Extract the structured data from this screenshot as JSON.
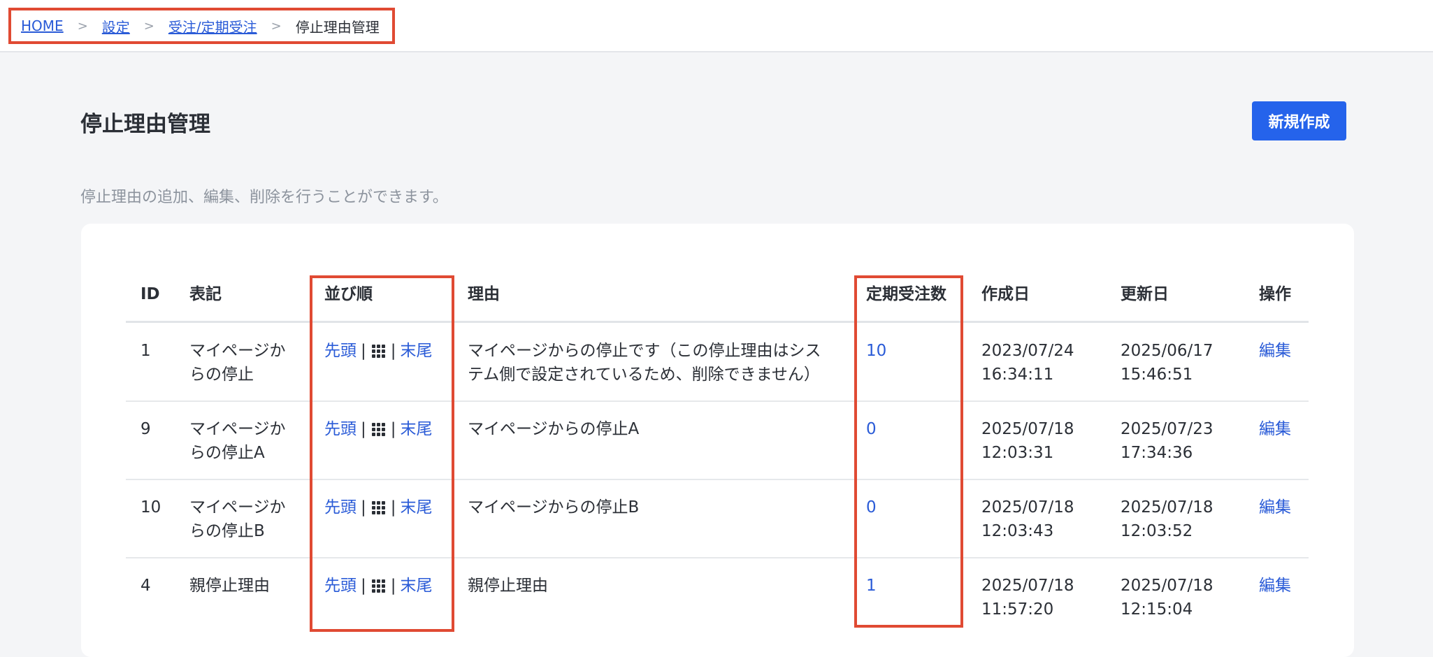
{
  "breadcrumb": {
    "items": [
      "HOME",
      "設定",
      "受注/定期受注"
    ],
    "separator": ">",
    "current": "停止理由管理"
  },
  "page": {
    "title": "停止理由管理",
    "new_button": "新規作成",
    "description": "停止理由の追加、編集、削除を行うことができます。"
  },
  "table": {
    "headers": [
      "ID",
      "表記",
      "並び順",
      "理由",
      "定期受注数",
      "作成日",
      "更新日",
      "操作"
    ],
    "order_controls": {
      "top": "先頭",
      "separator": "|",
      "bottom": "末尾",
      "drag_icon": "grid-drag-handle-icon"
    },
    "rows": [
      {
        "id": "1",
        "label": [
          "マイページか",
          "らの停止"
        ],
        "reason": [
          "マイページからの停止です（この停止理由はシス",
          "テム側で設定されているため、削除できません）"
        ],
        "count": "10",
        "created": [
          "2023/07/24",
          "16:34:11"
        ],
        "updated": [
          "2025/06/17",
          "15:46:51"
        ],
        "action": "編集"
      },
      {
        "id": "9",
        "label": [
          "マイページか",
          "らの停止A"
        ],
        "reason": [
          "マイページからの停止A"
        ],
        "count": "0",
        "created": [
          "2025/07/18",
          "12:03:31"
        ],
        "updated": [
          "2025/07/23",
          "17:34:36"
        ],
        "action": "編集"
      },
      {
        "id": "10",
        "label": [
          "マイページか",
          "らの停止B"
        ],
        "reason": [
          "マイページからの停止B"
        ],
        "count": "0",
        "created": [
          "2025/07/18",
          "12:03:43"
        ],
        "updated": [
          "2025/07/18",
          "12:03:52"
        ],
        "action": "編集"
      },
      {
        "id": "4",
        "label": [
          "親停止理由"
        ],
        "reason": [
          "親停止理由"
        ],
        "count": "1",
        "created": [
          "2025/07/18",
          "11:57:20"
        ],
        "updated": [
          "2025/07/18",
          "12:15:04"
        ],
        "action": "編集"
      }
    ]
  },
  "colors": {
    "accent": "#2563eb",
    "link": "#2a5bd7",
    "highlight": "#e04a33"
  }
}
